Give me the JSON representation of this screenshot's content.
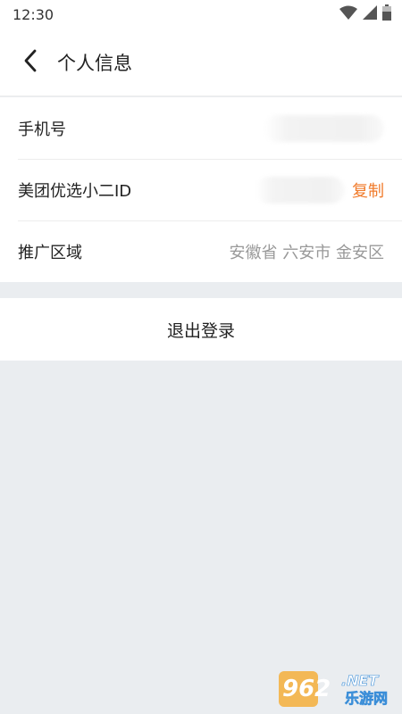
{
  "status_bar": {
    "time": "12:30",
    "icons": [
      "wifi-icon",
      "signal-icon",
      "battery-icon"
    ]
  },
  "header": {
    "title": "个人信息",
    "back_icon": "chevron-left-icon"
  },
  "info_rows": [
    {
      "label": "手机号",
      "value": "",
      "value_state": "blurred"
    },
    {
      "label": "美团优选小二ID",
      "value": "",
      "value_state": "blurred",
      "action": "复制"
    },
    {
      "label": "推广区域",
      "value": "安徽省 六安市 金安区"
    }
  ],
  "logout": {
    "label": "退出登录"
  },
  "watermark": {
    "brand_num": "962",
    "brand_suffix": ".NET",
    "brand_cn": "乐游网"
  },
  "colors": {
    "accent": "#f07a2a",
    "background": "#eaedf0",
    "card": "#ffffff",
    "secondary_text": "#999999"
  }
}
